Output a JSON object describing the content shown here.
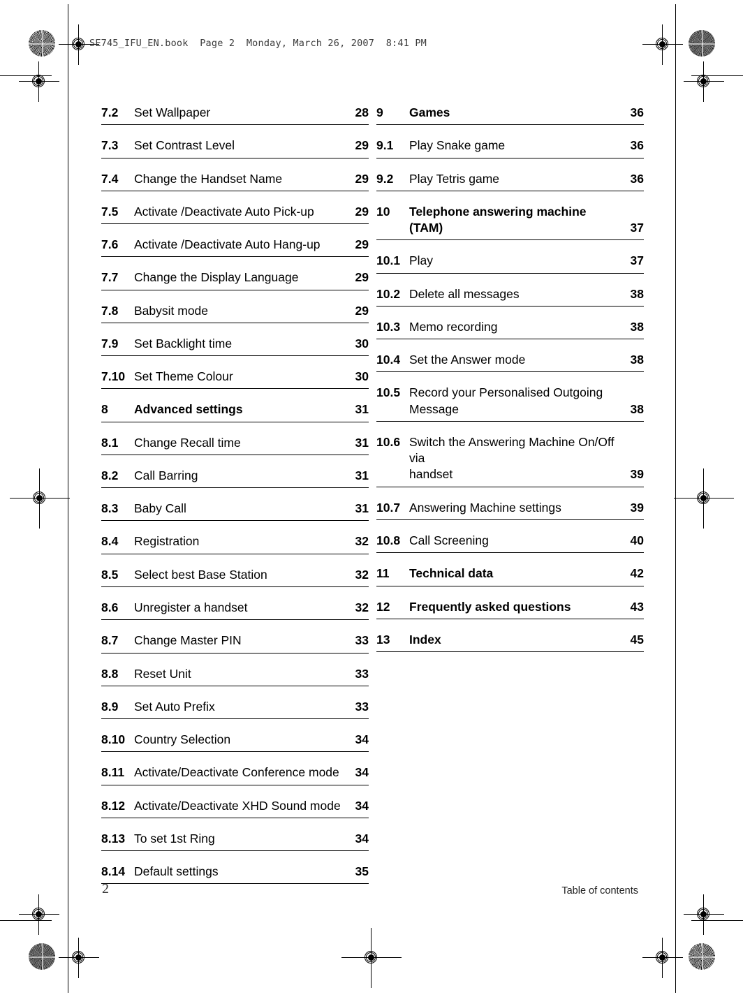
{
  "header": {
    "running_head": "SE745_IFU_EN.book  Page 2  Monday, March 26, 2007  8:41 PM"
  },
  "footer": {
    "page_number": "2",
    "section_label": "Table of contents"
  },
  "toc": {
    "left_column": [
      {
        "number": "7.2",
        "title": "Set Wallpaper",
        "page": "28",
        "level": 2
      },
      {
        "number": "7.3",
        "title": "Set Contrast Level",
        "page": "29",
        "level": 2
      },
      {
        "number": "7.4",
        "title": "Change the Handset Name",
        "page": "29",
        "level": 2
      },
      {
        "number": "7.5",
        "title": "Activate /Deactivate Auto Pick-up",
        "page": "29",
        "level": 2
      },
      {
        "number": "7.6",
        "title": "Activate /Deactivate Auto Hang-up",
        "page": "29",
        "level": 2
      },
      {
        "number": "7.7",
        "title": "Change the Display Language",
        "page": "29",
        "level": 2
      },
      {
        "number": "7.8",
        "title": "Babysit mode",
        "page": "29",
        "level": 2
      },
      {
        "number": "7.9",
        "title": "Set Backlight time",
        "page": "30",
        "level": 2
      },
      {
        "number": "7.10",
        "title": "Set Theme Colour",
        "page": "30",
        "level": 2
      },
      {
        "number": "8",
        "title": "Advanced settings",
        "page": "31",
        "level": 1,
        "gap": true
      },
      {
        "number": "8.1",
        "title": "Change Recall time",
        "page": "31",
        "level": 2
      },
      {
        "number": "8.2",
        "title": "Call Barring",
        "page": "31",
        "level": 2
      },
      {
        "number": "8.3",
        "title": "Baby Call",
        "page": "31",
        "level": 2
      },
      {
        "number": "8.4",
        "title": "Registration",
        "page": "32",
        "level": 2
      },
      {
        "number": "8.5",
        "title": "Select best Base Station",
        "page": "32",
        "level": 2
      },
      {
        "number": "8.6",
        "title": "Unregister a handset",
        "page": "32",
        "level": 2
      },
      {
        "number": "8.7",
        "title": "Change Master PIN",
        "page": "33",
        "level": 2
      },
      {
        "number": "8.8",
        "title": "Reset Unit",
        "page": "33",
        "level": 2
      },
      {
        "number": "8.9",
        "title": "Set Auto Prefix",
        "page": "33",
        "level": 2
      },
      {
        "number": "8.10",
        "title": "Country Selection",
        "page": "34",
        "level": 2
      },
      {
        "number": "8.11",
        "title": "Activate/Deactivate Conference mode",
        "page": "34",
        "level": 2
      },
      {
        "number": "8.12",
        "title": "Activate/Deactivate XHD Sound mode",
        "page": "34",
        "level": 2
      },
      {
        "number": "8.13",
        "title": "To set 1st Ring",
        "page": "34",
        "level": 2
      },
      {
        "number": "8.14",
        "title": "Default settings",
        "page": "35",
        "level": 2
      }
    ],
    "right_column": [
      {
        "number": "9",
        "title": "Games",
        "page": "36",
        "level": 1
      },
      {
        "number": "9.1",
        "title": "Play Snake game",
        "page": "36",
        "level": 2
      },
      {
        "number": "9.2",
        "title": "Play Tetris game",
        "page": "36",
        "level": 2
      },
      {
        "number": "10",
        "title": "Telephone answering machine",
        "title2": "(TAM)",
        "page": "37",
        "level": 1,
        "gap": true
      },
      {
        "number": "10.1",
        "title": "Play",
        "page": "37",
        "level": 2
      },
      {
        "number": "10.2",
        "title": "Delete all messages",
        "page": "38",
        "level": 2
      },
      {
        "number": "10.3",
        "title": "Memo recording",
        "page": "38",
        "level": 2
      },
      {
        "number": "10.4",
        "title": "Set the Answer mode",
        "page": "38",
        "level": 2
      },
      {
        "number": "10.5",
        "title": "Record your Personalised Outgoing",
        "title2": "Message",
        "page": "38",
        "level": 2
      },
      {
        "number": "10.6",
        "title": "Switch the Answering Machine On/Off via",
        "title2": "handset",
        "page": "39",
        "level": 2
      },
      {
        "number": "10.7",
        "title": "Answering Machine settings",
        "page": "39",
        "level": 2
      },
      {
        "number": "10.8",
        "title": "Call Screening",
        "page": "40",
        "level": 2
      },
      {
        "number": "11",
        "title": "Technical data",
        "page": "42",
        "level": 1,
        "gap": true
      },
      {
        "number": "12",
        "title": "Frequently asked questions",
        "page": "43",
        "level": 1,
        "gap": true
      },
      {
        "number": "13",
        "title": "Index",
        "page": "45",
        "level": 1,
        "gap": true
      }
    ]
  },
  "prepress": {
    "registration_target": "registration-target-icon",
    "rosette": "print-rosette-icon",
    "crop_mark": "crop-mark"
  }
}
